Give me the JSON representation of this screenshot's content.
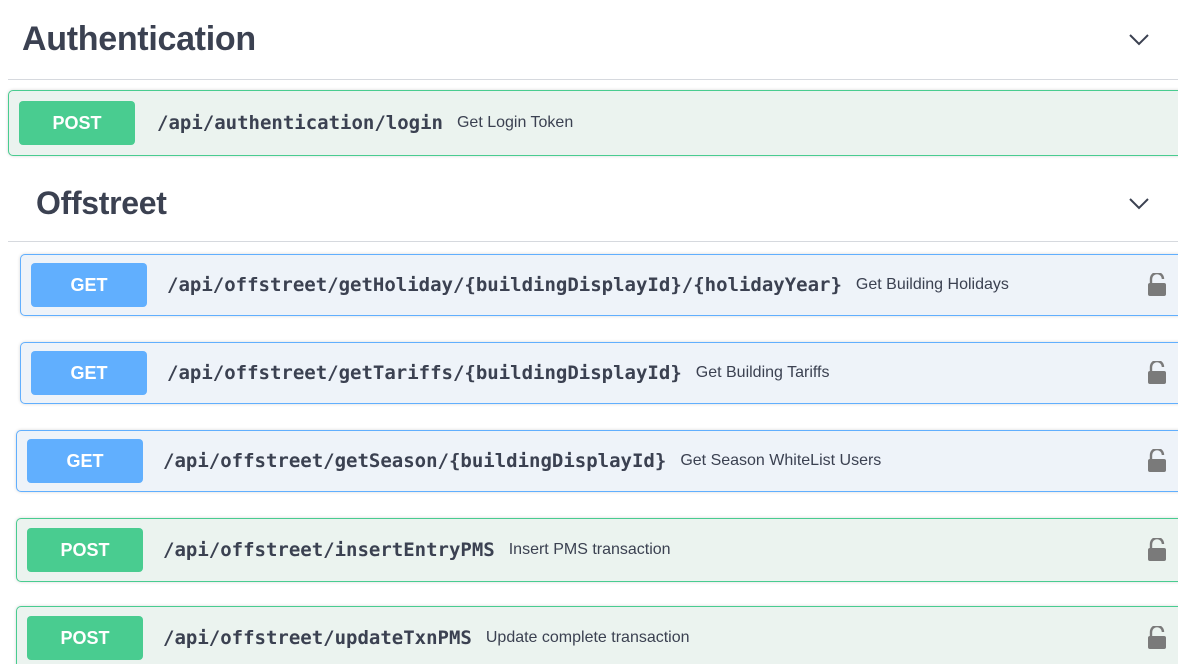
{
  "sections": [
    {
      "title": "Authentication",
      "chevron_icon": "chevron-down-icon",
      "operations": [
        {
          "method": "POST",
          "path": "/api/authentication/login",
          "summary": "Get Login Token",
          "locked": false
        }
      ]
    },
    {
      "title": "Offstreet",
      "chevron_icon": "chevron-down-icon",
      "operations": [
        {
          "method": "GET",
          "path": "/api/offstreet/getHoliday/{buildingDisplayId}/{holidayYear}",
          "summary": "Get Building Holidays",
          "locked": true,
          "lock_icon": "unlocked-padlock-icon"
        },
        {
          "method": "GET",
          "path": "/api/offstreet/getTariffs/{buildingDisplayId}",
          "summary": "Get Building Tariffs",
          "locked": true,
          "lock_icon": "unlocked-padlock-icon"
        },
        {
          "method": "GET",
          "path": "/api/offstreet/getSeason/{buildingDisplayId}",
          "summary": "Get Season WhiteList Users",
          "locked": true,
          "lock_icon": "unlocked-padlock-icon"
        },
        {
          "method": "POST",
          "path": "/api/offstreet/insertEntryPMS",
          "summary": "Insert PMS transaction",
          "locked": true,
          "lock_icon": "unlocked-padlock-icon"
        },
        {
          "method": "POST",
          "path": "/api/offstreet/updateTxnPMS",
          "summary": "Update complete transaction",
          "locked": true,
          "lock_icon": "unlocked-padlock-icon"
        }
      ]
    }
  ],
  "colors": {
    "post": "#49cc90",
    "get": "#61affe",
    "text": "#3b4151"
  }
}
